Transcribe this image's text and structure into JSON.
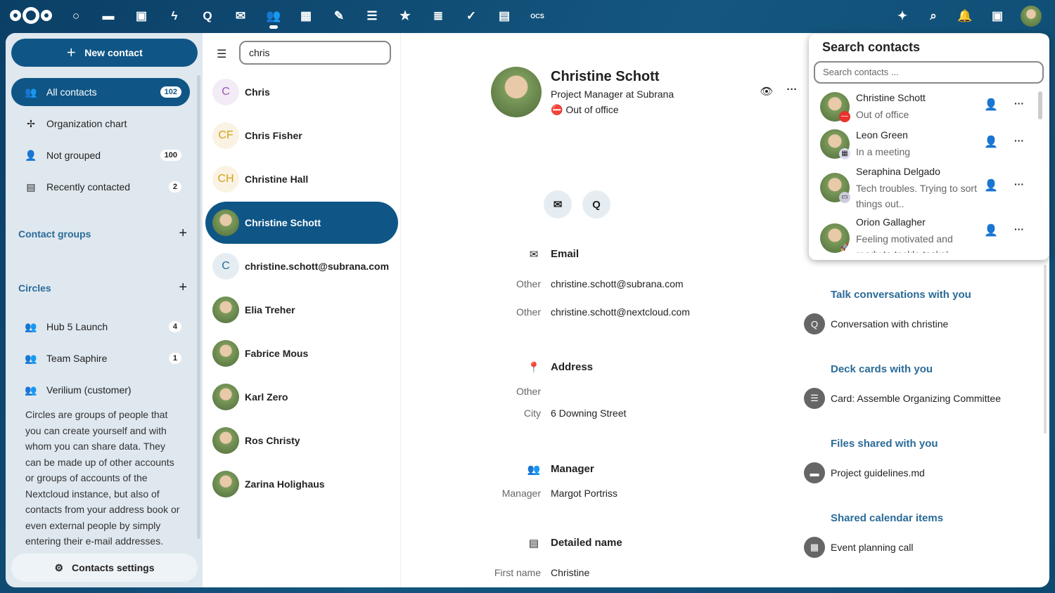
{
  "topbar": {
    "apps": [
      "dashboard",
      "files",
      "photos",
      "activity",
      "talk",
      "mail",
      "contacts",
      "calendar",
      "notes",
      "deck",
      "tasks-star",
      "lists",
      "tasks",
      "tables",
      "ocs"
    ],
    "right_icons": [
      "assistant-icon",
      "search-icon",
      "notifications-icon",
      "contacts-menu-icon",
      "user-avatar"
    ]
  },
  "sidebar": {
    "new_contact": "New contact",
    "nav": [
      {
        "label": "All contacts",
        "count": "102",
        "icon": "group"
      },
      {
        "label": "Organization chart",
        "icon": "org"
      },
      {
        "label": "Not grouped",
        "count": "100",
        "icon": "person"
      },
      {
        "label": "Recently contacted",
        "count": "2",
        "icon": "card"
      }
    ],
    "contact_groups": "Contact groups",
    "circles": "Circles",
    "circle_items": [
      {
        "label": "Hub 5 Launch",
        "count": "4"
      },
      {
        "label": "Team Saphire",
        "count": "1"
      },
      {
        "label": "Verilium (customer)"
      }
    ],
    "circles_desc": "Circles are groups of people that you can create yourself and with whom you can share data. They can be made up of other accounts or groups of accounts of the Nextcloud instance, but also of contacts from your address book or even external people by simply entering their e-mail addresses.",
    "settings": "Contacts settings"
  },
  "list": {
    "search_value": "chris",
    "items": [
      {
        "name": "Chris",
        "initials": "C",
        "color": "#9b59b6"
      },
      {
        "name": "Chris Fisher",
        "initials": "CF",
        "color": "#d4a017"
      },
      {
        "name": "Christine Hall",
        "initials": "CH",
        "color": "#d4a017"
      },
      {
        "name": "Christine Schott",
        "selected": true
      },
      {
        "name": "christine.schott@subrana.com",
        "initials": "C",
        "color": "#2a6b98"
      },
      {
        "name": "Elia Treher"
      },
      {
        "name": "Fabrice Mous"
      },
      {
        "name": "Karl Zero"
      },
      {
        "name": "Ros Christy"
      },
      {
        "name": "Zarina Holighaus"
      }
    ]
  },
  "detail": {
    "name": "Christine Schott",
    "title": "Project Manager at Subrana",
    "status": "Out of office",
    "email": {
      "header": "Email",
      "rows": [
        {
          "label": "Other",
          "value": "christine.schott@subrana.com"
        },
        {
          "label": "Other",
          "value": "christine.schott@nextcloud.com"
        }
      ]
    },
    "address": {
      "header": "Address",
      "type": "Other",
      "city_label": "City",
      "city": "6 Downing Street"
    },
    "manager": {
      "header": "Manager",
      "label": "Manager",
      "value": "Margot Portriss"
    },
    "detailed_name": {
      "header": "Detailed name",
      "label": "First name",
      "value": "Christine"
    },
    "related": [
      {
        "title": "Talk conversations with you",
        "item": "Conversation with christine"
      },
      {
        "title": "Deck cards with you",
        "item": "Card: Assemble Organizing Committee"
      },
      {
        "title": "Files shared with you",
        "item": "Project guidelines.md"
      },
      {
        "title": "Shared calendar items",
        "item": "Event planning call"
      }
    ]
  },
  "popover": {
    "title": "Search contacts",
    "placeholder": "Search contacts ...",
    "items": [
      {
        "name": "Christine Schott",
        "status": "Out of office"
      },
      {
        "name": "Leon Green",
        "status": "In a meeting"
      },
      {
        "name": "Seraphina Delgado",
        "status": "Tech troubles. Trying to sort things out.."
      },
      {
        "name": "Orion Gallagher",
        "status": "Feeling motivated and ready to tackle tasks!"
      }
    ]
  },
  "colors": {
    "primary": "#0f5686",
    "accent_text": "#2a6b98",
    "sidebar_bg": "#dfe8ef",
    "dnd": "#e9322d"
  }
}
